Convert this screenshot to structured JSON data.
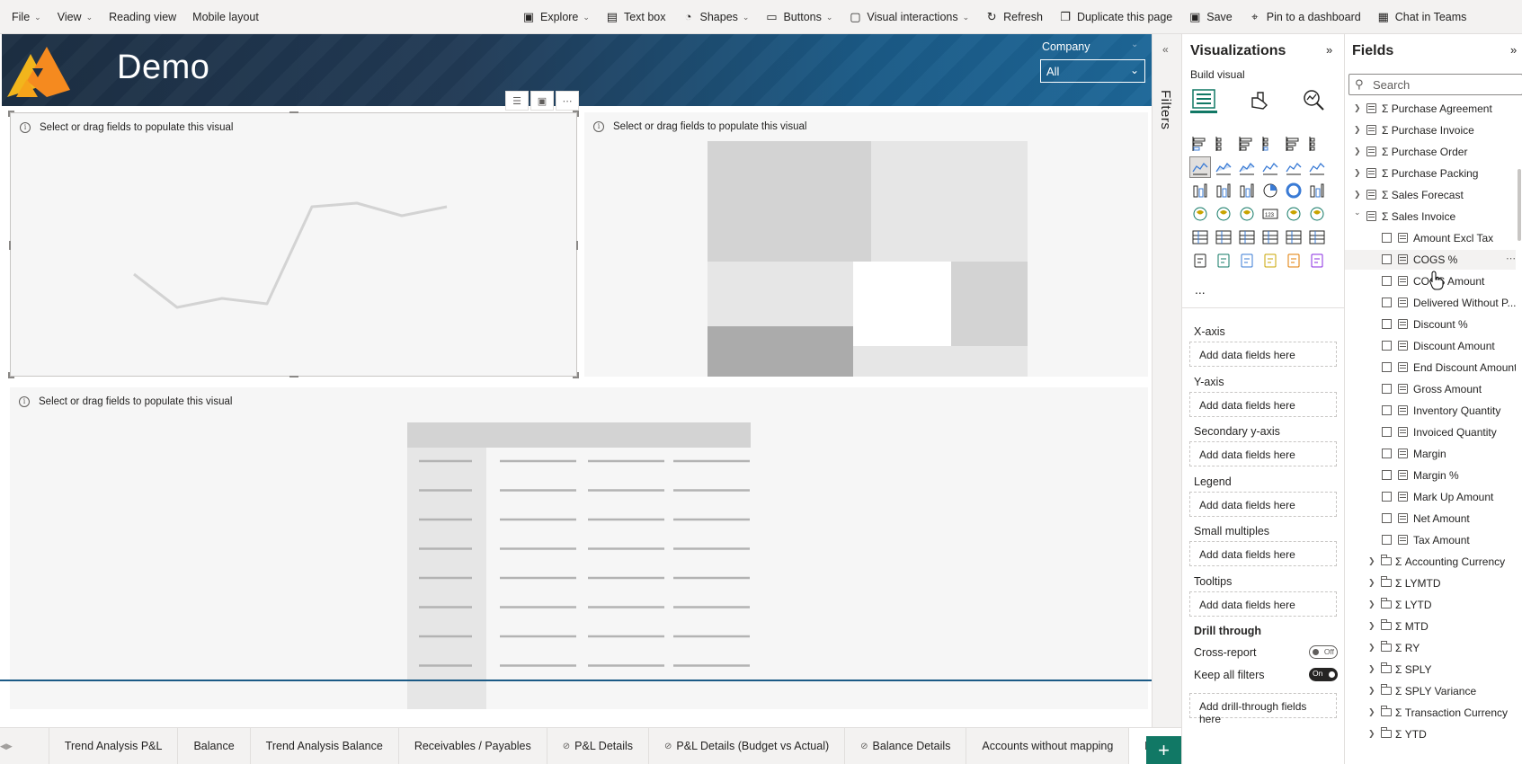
{
  "toolbar": {
    "left": [
      {
        "label": "File",
        "has_chevron": true
      },
      {
        "label": "View",
        "has_chevron": true
      },
      {
        "label": "Reading view",
        "has_chevron": false
      },
      {
        "label": "Mobile layout",
        "has_chevron": false
      }
    ],
    "right": [
      {
        "label": "Explore",
        "icon": "explore-icon",
        "has_chevron": true
      },
      {
        "label": "Text box",
        "icon": "text-box-icon",
        "has_chevron": false
      },
      {
        "label": "Shapes",
        "icon": "shapes-icon",
        "has_chevron": true
      },
      {
        "label": "Buttons",
        "icon": "buttons-icon",
        "has_chevron": true
      },
      {
        "label": "Visual interactions",
        "icon": "visual-interactions-icon",
        "has_chevron": true
      },
      {
        "label": "Refresh",
        "icon": "refresh-icon",
        "has_chevron": false
      },
      {
        "label": "Duplicate this page",
        "icon": "duplicate-icon",
        "has_chevron": false
      },
      {
        "label": "Save",
        "icon": "save-icon",
        "has_chevron": false
      },
      {
        "label": "Pin to a dashboard",
        "icon": "pin-icon",
        "has_chevron": false
      },
      {
        "label": "Chat in Teams",
        "icon": "teams-icon",
        "has_chevron": false
      }
    ]
  },
  "report": {
    "title": "Demo",
    "slicer": {
      "label": "Company",
      "value": "All"
    },
    "placeholder_text": "Select or drag fields to populate this visual"
  },
  "pages": [
    {
      "label": "Trend Analysis P&L",
      "hidden": false,
      "active": false
    },
    {
      "label": "Balance",
      "hidden": false,
      "active": false
    },
    {
      "label": "Trend Analysis Balance",
      "hidden": false,
      "active": false
    },
    {
      "label": "Receivables / Payables",
      "hidden": false,
      "active": false
    },
    {
      "label": "P&L Details",
      "hidden": true,
      "active": false
    },
    {
      "label": "P&L Details (Budget vs Actual)",
      "hidden": true,
      "active": false
    },
    {
      "label": "Balance Details",
      "hidden": true,
      "active": false
    },
    {
      "label": "Accounts without mapping",
      "hidden": false,
      "active": false
    },
    {
      "label": "Demo",
      "hidden": false,
      "active": true
    }
  ],
  "filters_pane": {
    "label": "Filters"
  },
  "visualizations": {
    "title": "Visualizations",
    "subtitle": "Build visual",
    "more": "...",
    "wells": [
      {
        "label": "X-axis",
        "drop": "Add data fields here"
      },
      {
        "label": "Y-axis",
        "drop": "Add data fields here"
      },
      {
        "label": "Secondary y-axis",
        "drop": "Add data fields here"
      },
      {
        "label": "Legend",
        "drop": "Add data fields here"
      },
      {
        "label": "Small multiples",
        "drop": "Add data fields here"
      },
      {
        "label": "Tooltips",
        "drop": "Add data fields here"
      }
    ],
    "drill_through": {
      "label": "Drill through",
      "cross_report": {
        "label": "Cross-report",
        "state": "Off"
      },
      "keep_all_filters": {
        "label": "Keep all filters",
        "state": "On"
      },
      "drop": "Add drill-through fields here"
    }
  },
  "fields": {
    "title": "Fields",
    "search_placeholder": "Search",
    "tables": [
      {
        "label": "Σ Purchase Agreement"
      },
      {
        "label": "Σ Purchase Invoice"
      },
      {
        "label": "Σ Purchase Order"
      },
      {
        "label": "Σ Purchase Packing"
      },
      {
        "label": "Σ Sales Forecast"
      }
    ],
    "expanded_table": {
      "label": "Σ Sales Invoice",
      "measures": [
        "Amount Excl Tax",
        "COGS %",
        "COGS Amount",
        "Delivered Without P...",
        "Discount %",
        "Discount Amount",
        "End Discount Amount",
        "Gross Amount",
        "Inventory Quantity",
        "Invoiced Quantity",
        "Margin",
        "Margin %",
        "Mark Up Amount",
        "Net Amount",
        "Tax Amount"
      ],
      "folders": [
        "Σ Accounting Currency",
        "Σ LYMTD",
        "Σ LYTD",
        "Σ MTD",
        "Σ RY",
        "Σ SPLY",
        "Σ SPLY Variance",
        "Σ Transaction Currency",
        "Σ YTD"
      ]
    }
  },
  "colors": {
    "accent": "#117865",
    "banner": "#1d2f43",
    "banner_right": "#1d6798"
  }
}
